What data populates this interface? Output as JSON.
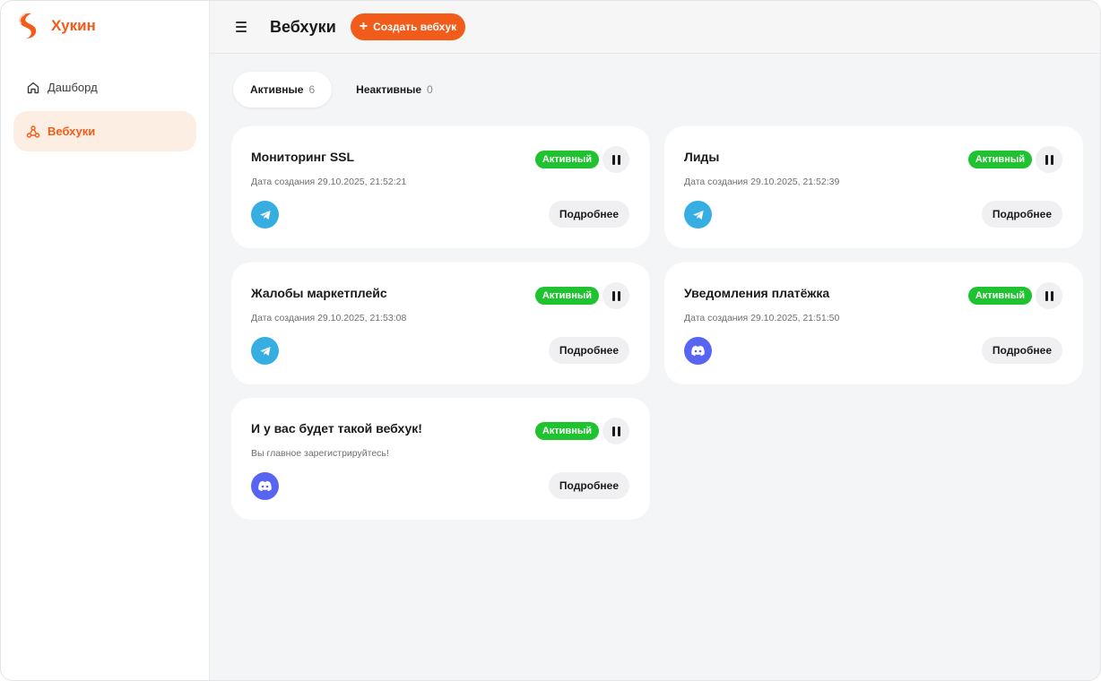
{
  "brand": {
    "name": "Хукин",
    "color": "#f25c1a"
  },
  "sidebar": {
    "items": [
      {
        "label": "Дашборд",
        "icon": "home-icon",
        "active": false
      },
      {
        "label": "Вебхуки",
        "icon": "webhook-icon",
        "active": true
      }
    ]
  },
  "header": {
    "title": "Вебхуки",
    "create_label": "Создать вебхук",
    "menu_icon": "hamburger-icon"
  },
  "tabs": [
    {
      "label": "Активные",
      "count": "6",
      "active": true
    },
    {
      "label": "Неактивные",
      "count": "0",
      "active": false
    }
  ],
  "cards": [
    {
      "title": "Мониторинг SSL",
      "subtitle": "Дата создания 29.10.2025, 21:52:21",
      "status": "Активный",
      "channel": "telegram",
      "details_label": "Подробнее"
    },
    {
      "title": "Лиды",
      "subtitle": "Дата создания 29.10.2025, 21:52:39",
      "status": "Активный",
      "channel": "telegram",
      "details_label": "Подробнее"
    },
    {
      "title": "Жалобы маркетплейс",
      "subtitle": "Дата создания 29.10.2025, 21:53:08",
      "status": "Активный",
      "channel": "telegram",
      "details_label": "Подробнее"
    },
    {
      "title": "Уведомления платёжка",
      "subtitle": "Дата создания 29.10.2025, 21:51:50",
      "status": "Активный",
      "channel": "discord",
      "details_label": "Подробнее"
    },
    {
      "title": "И у вас будет такой вебхук!",
      "subtitle": "Вы главное зарегистрируйтесь!",
      "status": "Активный",
      "channel": "discord",
      "details_label": "Подробнее"
    }
  ],
  "colors": {
    "accent": "#f25c1a",
    "active_badge": "#1ec32f",
    "telegram": "#37aee2",
    "discord": "#5865f2"
  }
}
